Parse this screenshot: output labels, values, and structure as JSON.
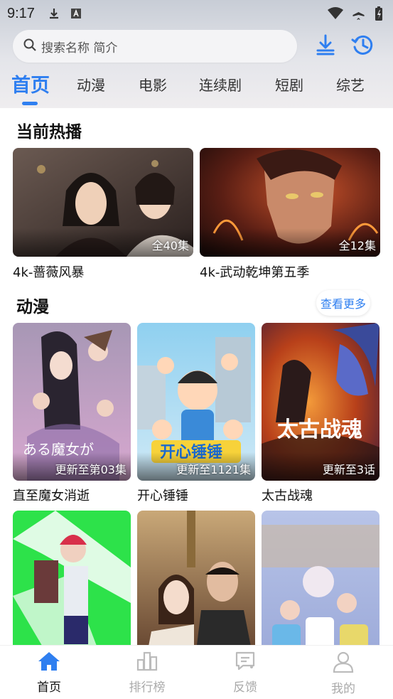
{
  "status_bar": {
    "time": "9:17",
    "icons": [
      "download-icon",
      "font-icon",
      "wifi-icon",
      "airplane-icon",
      "battery-charging-icon"
    ]
  },
  "search": {
    "placeholder": "搜索名称 简介",
    "icon": "search-icon"
  },
  "header_actions": [
    "download-icon",
    "history-icon"
  ],
  "tabs": [
    {
      "label": "首页",
      "active": true
    },
    {
      "label": "动漫"
    },
    {
      "label": "电影"
    },
    {
      "label": "连续剧"
    },
    {
      "label": "短剧"
    },
    {
      "label": "综艺"
    }
  ],
  "sections": {
    "hot": {
      "title": "当前热播",
      "items": [
        {
          "name": "4k-蔷薇风暴",
          "badge": "全40集",
          "color": "#4a3a36"
        },
        {
          "name": "4k-武动乾坤第五季",
          "badge": "全12集",
          "color": "#7a2e1c"
        }
      ]
    },
    "anime": {
      "title": "动漫",
      "more_label": "查看更多",
      "items": [
        {
          "name": "直至魔女消逝",
          "badge": "更新至第03集",
          "color": "#b8a4c8"
        },
        {
          "name": "开心锤锤",
          "badge": "更新至1121集",
          "color": "#7ec0e8"
        },
        {
          "name": "太古战魂",
          "badge": "更新至3话",
          "color": "#c8541e"
        },
        {
          "name": "",
          "badge": "",
          "color": "#2de24a"
        },
        {
          "name": "",
          "badge": "",
          "color": "#8a6a4a"
        },
        {
          "name": "",
          "badge": "",
          "color": "#9aa8d8"
        }
      ]
    }
  },
  "tabbar": [
    {
      "label": "首页",
      "icon": "home-icon",
      "active": true
    },
    {
      "label": "排行榜",
      "icon": "ranking-icon"
    },
    {
      "label": "反馈",
      "icon": "feedback-icon"
    },
    {
      "label": "我的",
      "icon": "profile-icon"
    }
  ],
  "colors": {
    "accent": "#2f7ff0"
  }
}
